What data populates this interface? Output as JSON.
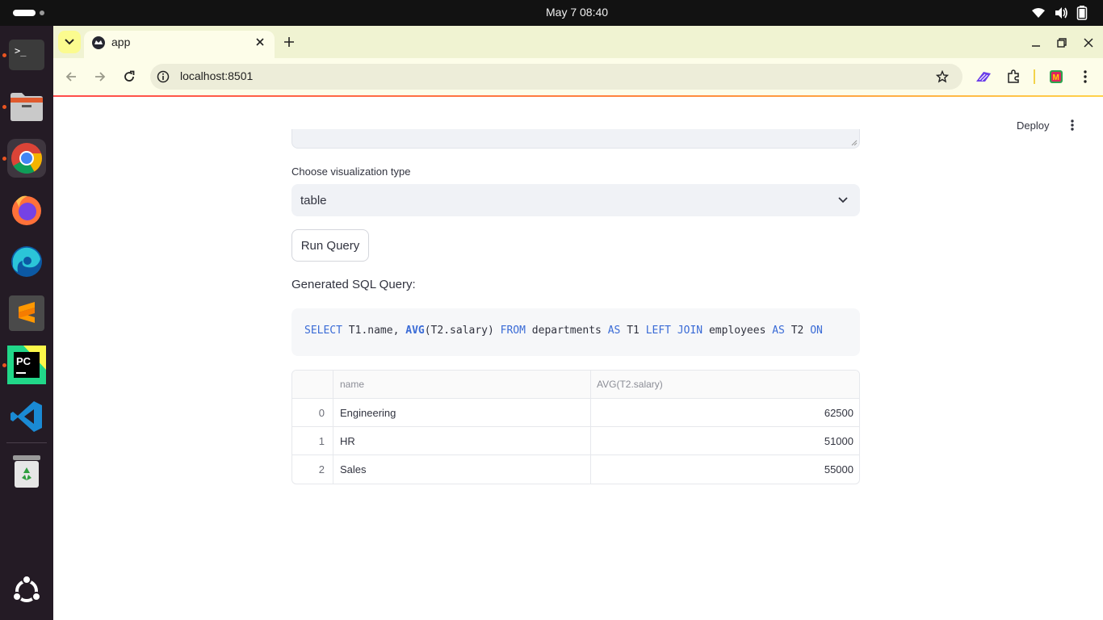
{
  "system_bar": {
    "clock": "May 7  08:40"
  },
  "dock": {
    "apps": [
      {
        "name": "terminal-icon",
        "running": true
      },
      {
        "name": "files-icon",
        "running": true
      },
      {
        "name": "chrome-icon",
        "running": true,
        "active": true
      },
      {
        "name": "firefox-icon",
        "running": false
      },
      {
        "name": "edge-icon",
        "running": false
      },
      {
        "name": "sublime-icon",
        "running": false
      },
      {
        "name": "pycharm-icon",
        "running": true
      },
      {
        "name": "vscode-icon",
        "running": false
      },
      {
        "name": "trash-icon",
        "running": false
      },
      {
        "name": "ubuntu-apps-icon",
        "running": false
      }
    ]
  },
  "browser": {
    "tab_title": "app",
    "url": "localhost:8501"
  },
  "app": {
    "deploy_label": "Deploy",
    "viz_label": "Choose visualization type",
    "viz_selected": "table",
    "run_label": "Run Query",
    "sql_heading": "Generated SQL Query:",
    "sql_tokens": [
      {
        "t": "SELECT",
        "k": "kw"
      },
      {
        "t": " T1.name, ",
        "k": ""
      },
      {
        "t": "AVG",
        "k": "fn"
      },
      {
        "t": "(T2.salary) ",
        "k": ""
      },
      {
        "t": "FROM",
        "k": "kw"
      },
      {
        "t": " departments ",
        "k": ""
      },
      {
        "t": "AS",
        "k": "kw"
      },
      {
        "t": " T1 ",
        "k": ""
      },
      {
        "t": "LEFT JOIN",
        "k": "kw"
      },
      {
        "t": " employees ",
        "k": ""
      },
      {
        "t": "AS",
        "k": "kw"
      },
      {
        "t": " T2 ",
        "k": ""
      },
      {
        "t": "ON",
        "k": "kw"
      }
    ],
    "table": {
      "columns": [
        "",
        "name",
        "AVG(T2.salary)"
      ],
      "rows": [
        {
          "index": "0",
          "name": "Engineering",
          "avg": "62500"
        },
        {
          "index": "1",
          "name": "HR",
          "avg": "51000"
        },
        {
          "index": "2",
          "name": "Sales",
          "avg": "55000"
        }
      ]
    }
  },
  "colors": {
    "accent": "#ff4b4b",
    "dock_bg": "#241b25",
    "tabstrip_bg": "#f0f3d2"
  }
}
